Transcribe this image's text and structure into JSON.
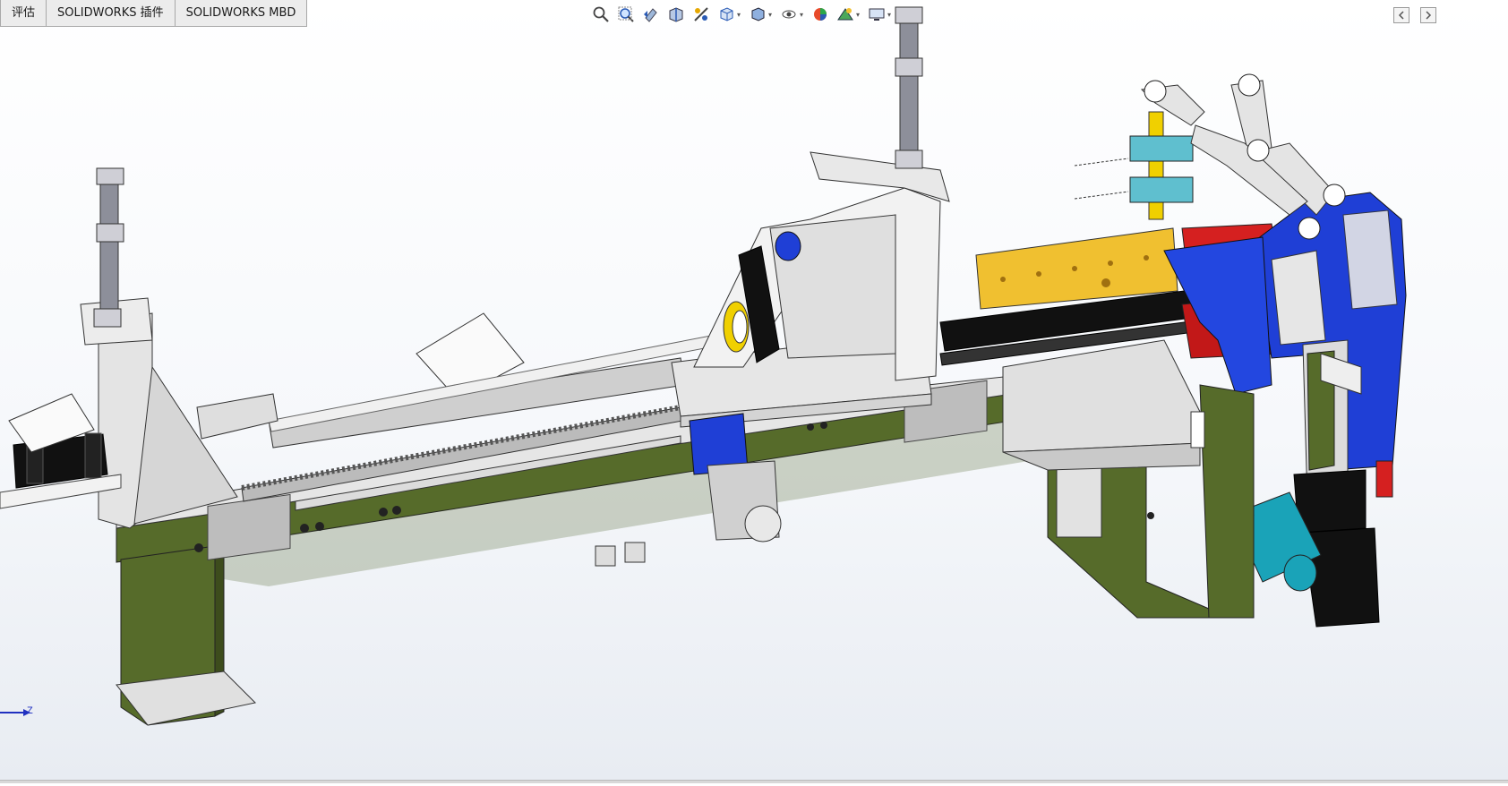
{
  "tabs": [
    {
      "label": "评估"
    },
    {
      "label": "SOLIDWORKS 插件"
    },
    {
      "label": "SOLIDWORKS MBD"
    }
  ],
  "headsup_toolbar": [
    {
      "icon": "zoom-to-fit-icon"
    },
    {
      "icon": "zoom-to-area-icon"
    },
    {
      "icon": "previous-view-icon"
    },
    {
      "icon": "section-view-icon"
    },
    {
      "icon": "dynamic-annotation-icon"
    },
    {
      "icon": "view-orientation-icon"
    },
    {
      "icon": "display-style-icon"
    },
    {
      "icon": "hide-show-items-icon"
    },
    {
      "icon": "edit-appearance-icon"
    },
    {
      "icon": "apply-scene-icon"
    },
    {
      "icon": "view-settings-icon"
    }
  ],
  "triad": {
    "axis_label": "Z"
  },
  "colors": {
    "background_top": "#ffffff",
    "background_bottom": "#eef1f6",
    "frame_green": "#566b2a",
    "frame_white": "#e8e8e8",
    "assembly_blue": "#1f3fd6",
    "assembly_red": "#d52020",
    "plate_yellow": "#f0c030",
    "cylinder_black": "#111111",
    "clamp_cyan": "#5fbfcf",
    "motor_teal": "#1aa3b8"
  }
}
